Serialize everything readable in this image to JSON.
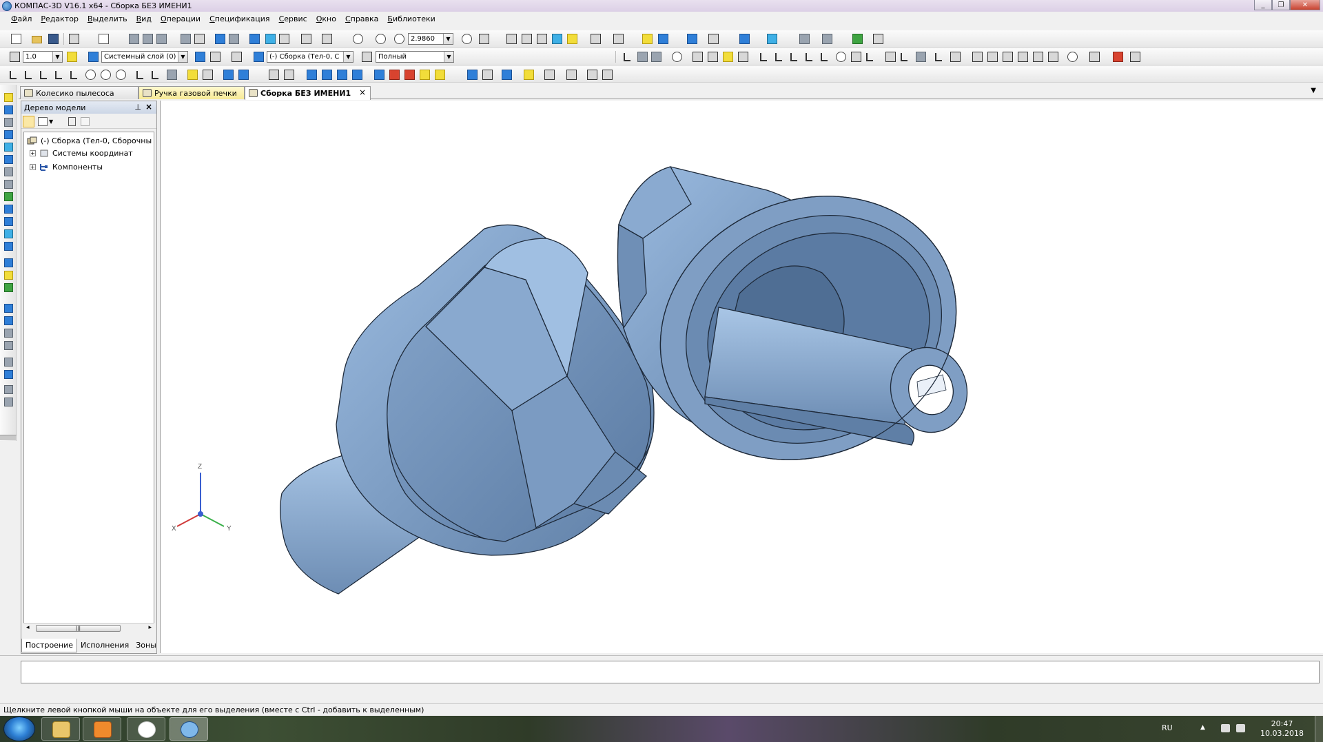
{
  "window": {
    "title": "КОМПАС-3D V16.1 x64 - Сборка БЕЗ ИМЕНИ1",
    "controls": [
      "_",
      "❐",
      "✕"
    ]
  },
  "menu": [
    "Файл",
    "Редактор",
    "Выделить",
    "Вид",
    "Операции",
    "Спецификация",
    "Сервис",
    "Окно",
    "Справка",
    "Библиотеки"
  ],
  "toolbar": {
    "zoom_value": "2.9860",
    "line_width": "1.0",
    "layer": "Системный слой (0)",
    "assembly_select": "(-) Сборка (Тел-0, С",
    "display_mode": "Полный"
  },
  "tabs": [
    {
      "label": "Колесико пылесоса",
      "active": false
    },
    {
      "label": "Ручка газовой печки",
      "active": false
    },
    {
      "label": "Сборка БЕЗ ИМЕНИ1",
      "active": true
    }
  ],
  "tree": {
    "title": "Дерево модели",
    "nodes": [
      {
        "label": "(-) Сборка (Тел-0, Сборочны"
      },
      {
        "label": "Системы координат"
      },
      {
        "label": "Компоненты"
      }
    ],
    "bottom_tabs": [
      "Построение",
      "Исполнения",
      "Зоны"
    ]
  },
  "axes": {
    "x": "X",
    "y": "Y",
    "z": "Z"
  },
  "statusbar": {
    "hint": "Щелкните левой кнопкой мыши на объекте для его выделения (вместе с Ctrl - добавить к выделенным)"
  },
  "taskbar": {
    "lang": "RU",
    "time": "20:47",
    "date": "10.03.2018"
  },
  "colors": {
    "model_fill": "#7f9ec4",
    "model_light": "#a9c6e6",
    "model_dark": "#4f6e94",
    "edge": "#1e2a3a"
  }
}
